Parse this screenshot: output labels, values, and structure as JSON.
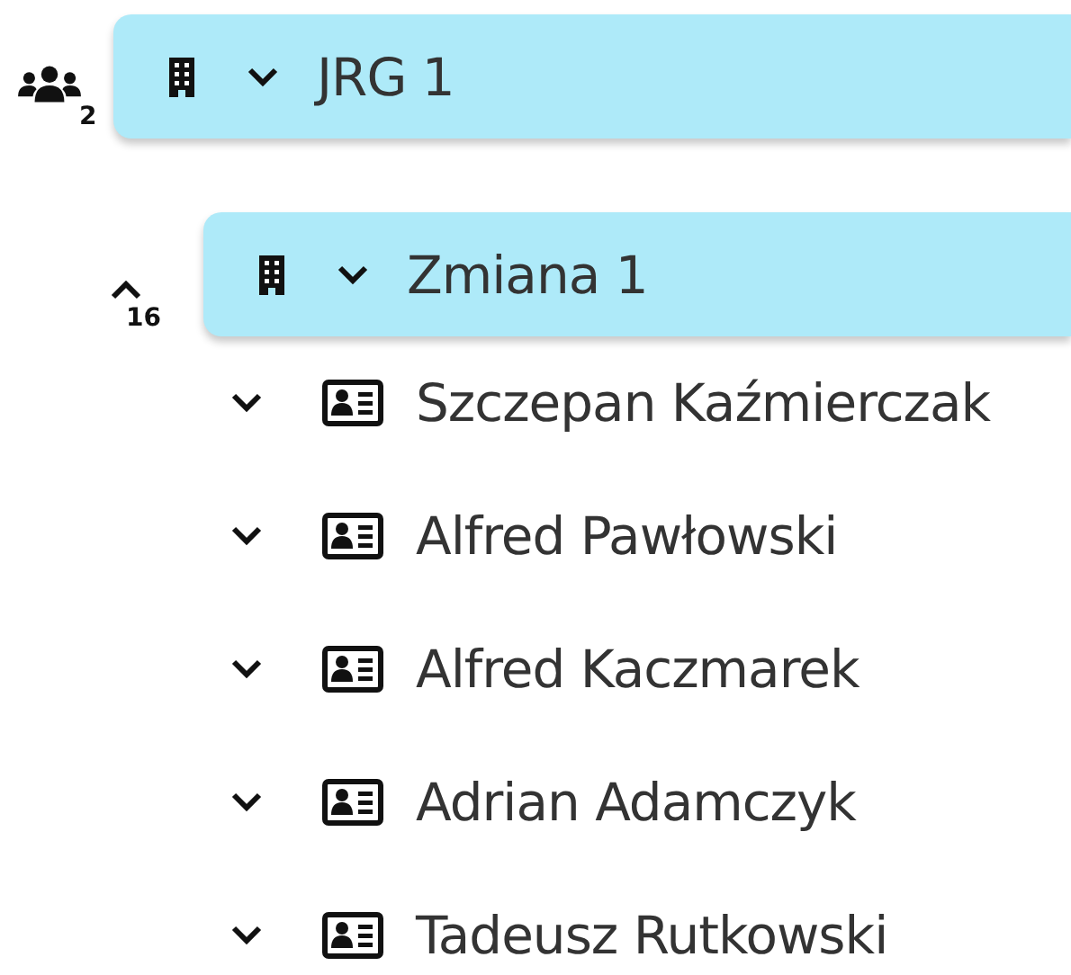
{
  "tree": [
    {
      "kind": "unit",
      "name": "JRG 1",
      "badge": {
        "kind": "people",
        "count": "2"
      },
      "children": [
        {
          "kind": "unit",
          "name": "Zmiana 1",
          "badge": {
            "kind": "toggle",
            "count": "16"
          },
          "expanded": true,
          "children": [
            {
              "kind": "person",
              "name": "Szczepan Kaźmierczak",
              "expanded": false
            },
            {
              "kind": "person",
              "name": "Alfred Pawłowski",
              "expanded": false
            },
            {
              "kind": "person",
              "name": "Alfred Kaczmarek",
              "expanded": false
            },
            {
              "kind": "person",
              "name": "Adrian Adamczyk",
              "expanded": false
            },
            {
              "kind": "person",
              "name": "Tadeusz Rutkowski",
              "expanded": false
            }
          ]
        }
      ]
    }
  ]
}
